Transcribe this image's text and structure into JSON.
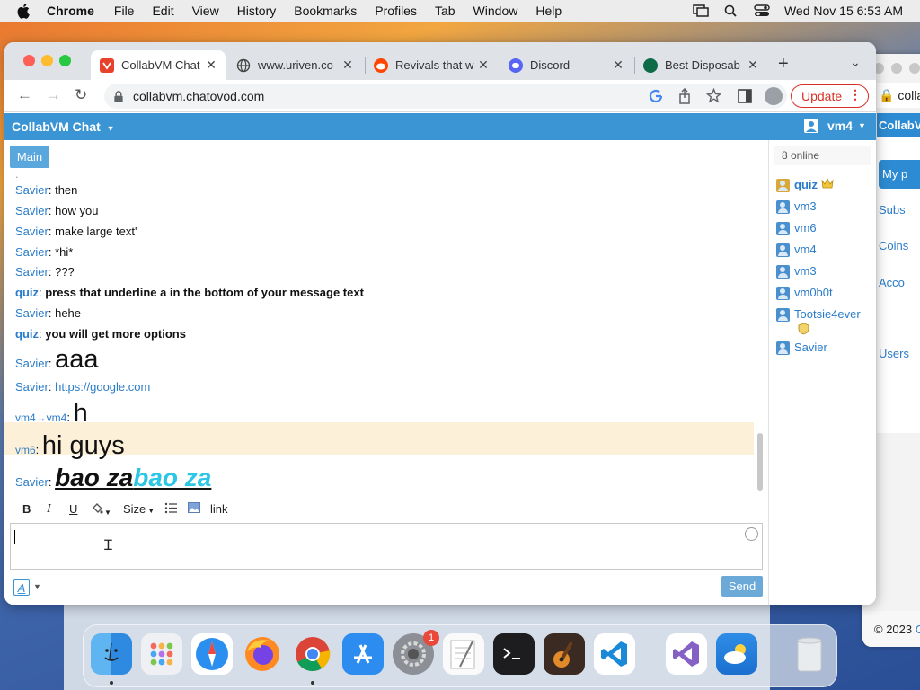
{
  "menubar": {
    "app_name": "Chrome",
    "items": [
      "File",
      "Edit",
      "View",
      "History",
      "Bookmarks",
      "Profiles",
      "Tab",
      "Window",
      "Help"
    ],
    "clock": "Wed Nov 15  6:53 AM"
  },
  "browser": {
    "tabs": [
      {
        "title": "CollabVM Chat",
        "icon": "collabvm-icon",
        "active": true
      },
      {
        "title": "www.uriven.co",
        "icon": "globe-icon",
        "active": false
      },
      {
        "title": "Revivals that w",
        "icon": "reddit-icon",
        "active": false
      },
      {
        "title": "Discord",
        "icon": "discord-icon",
        "active": false
      },
      {
        "title": "Best Disposab",
        "icon": "site-icon",
        "active": false
      }
    ],
    "url": "collabvm.chatovod.com",
    "update_label": "Update"
  },
  "chat": {
    "brand": "CollabVM Chat",
    "current_user": "vm4",
    "channel": "Main",
    "truncated_marker": ".",
    "messages": [
      {
        "author": "Savier",
        "text": "then"
      },
      {
        "author": "Savier",
        "text": "how you"
      },
      {
        "author": "Savier",
        "text": "make large text'"
      },
      {
        "author": "Savier",
        "text": "*hi*"
      },
      {
        "author": "Savier",
        "text": "???"
      },
      {
        "author": "quiz",
        "text": "press that underline a in the bottom of your message text"
      },
      {
        "author": "Savier",
        "text": "hehe"
      },
      {
        "author": "quiz",
        "text": "you will get more options"
      },
      {
        "author": "Savier",
        "text": "aaa"
      },
      {
        "author": "Savier",
        "text": "https://google.com"
      },
      {
        "author": "vm4→vm4",
        "text": "h"
      },
      {
        "author": "vm6",
        "text": "hi guys"
      },
      {
        "author": "Savier",
        "text_part1": "bao za",
        "text_part2": "bao za"
      }
    ],
    "toolbar": {
      "bold": "B",
      "italic": "I",
      "underline": "U",
      "size": "Size",
      "link": "link"
    },
    "font_button": "A",
    "send_label": "Send",
    "online_count": "8 online",
    "users": [
      {
        "name": "quiz",
        "role": "crown"
      },
      {
        "name": "vm3",
        "role": ""
      },
      {
        "name": "vm6",
        "role": ""
      },
      {
        "name": "vm4",
        "role": ""
      },
      {
        "name": "vm3",
        "role": ""
      },
      {
        "name": "vm0b0t",
        "role": ""
      },
      {
        "name": "Tootsie4ever",
        "role": "shield"
      },
      {
        "name": "Savier",
        "role": ""
      }
    ]
  },
  "background_window": {
    "address": "colla",
    "app_bar": "CollabVM",
    "nav": [
      "My p",
      "Subs",
      "Coins",
      "Acco",
      "Users"
    ]
  },
  "footer": {
    "copyright": "© 2023",
    "link": "C"
  },
  "dock": {
    "notification_count": "1"
  }
}
